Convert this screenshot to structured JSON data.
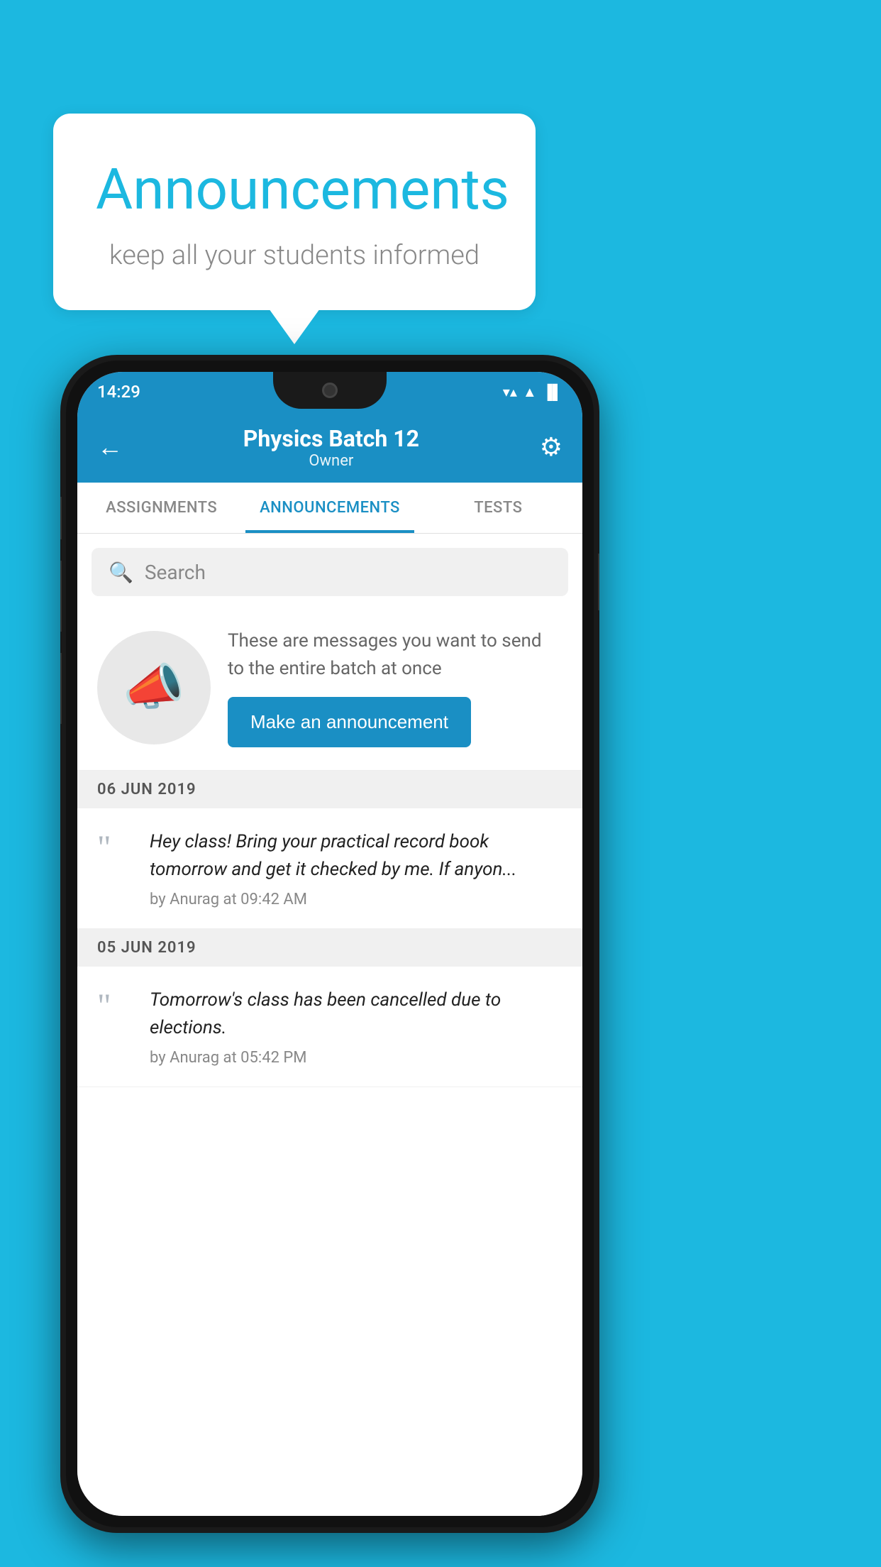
{
  "background_color": "#1cb8e0",
  "speech_bubble": {
    "title": "Announcements",
    "subtitle": "keep all your students informed"
  },
  "status_bar": {
    "time": "14:29",
    "wifi": "▼",
    "signal": "▲",
    "battery": "▐"
  },
  "app_header": {
    "back_label": "←",
    "title": "Physics Batch 12",
    "subtitle": "Owner",
    "settings_label": "⚙"
  },
  "tabs": [
    {
      "label": "ASSIGNMENTS",
      "active": false
    },
    {
      "label": "ANNOUNCEMENTS",
      "active": true
    },
    {
      "label": "TESTS",
      "active": false
    }
  ],
  "search": {
    "placeholder": "Search"
  },
  "announcement_promo": {
    "description": "These are messages you want to send to the entire batch at once",
    "button_label": "Make an announcement"
  },
  "announcements": [
    {
      "date": "06  JUN  2019",
      "text": "Hey class! Bring your practical record book tomorrow and get it checked by me. If anyon...",
      "meta": "by Anurag at 09:42 AM"
    },
    {
      "date": "05  JUN  2019",
      "text": "Tomorrow's class has been cancelled due to elections.",
      "meta": "by Anurag at 05:42 PM"
    }
  ]
}
